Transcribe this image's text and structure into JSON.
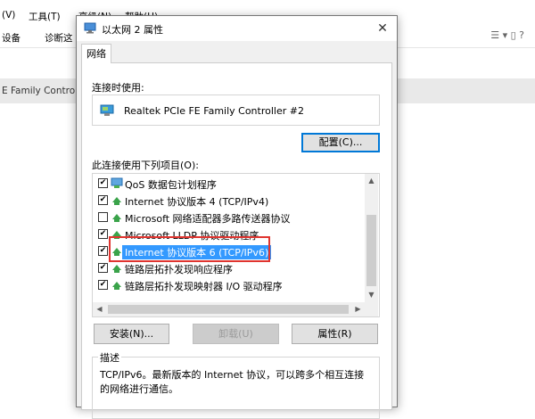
{
  "background": {
    "menu": [
      "(V)",
      "工具(T)",
      "高级(N)",
      "帮助(H)"
    ],
    "toolbar": [
      "设备",
      "诊断这"
    ],
    "list_item": "E Family Contro",
    "view_icons": "☰ ▾ ▯ ?"
  },
  "dialog": {
    "title": "以太网 2 属性",
    "close": "✕",
    "tab": "网络",
    "connect_using_label": "连接时使用:",
    "adapter_name": "Realtek PCIe FE Family Controller #2",
    "configure_button": "配置(C)...",
    "items_label": "此连接使用下列项目(O):",
    "items": [
      {
        "label": "QoS 数据包计划程序",
        "checked": true,
        "icon": "qos-icon"
      },
      {
        "label": "Internet 协议版本 4 (TCP/IPv4)",
        "checked": true,
        "icon": "protocol-icon"
      },
      {
        "label": "Microsoft 网络适配器多路传送器协议",
        "checked": false,
        "icon": "protocol-icon"
      },
      {
        "label": "Microsoft LLDP 协议驱动程序",
        "checked": true,
        "icon": "protocol-icon"
      },
      {
        "label": "Internet 协议版本 6 (TCP/IPv6)",
        "checked": true,
        "icon": "protocol-icon",
        "selected": true
      },
      {
        "label": "链路层拓扑发现响应程序",
        "checked": true,
        "icon": "protocol-icon"
      },
      {
        "label": "链路层拓扑发现映射器 I/O 驱动程序",
        "checked": true,
        "icon": "protocol-icon"
      }
    ],
    "install_button": "安装(N)...",
    "uninstall_button": "卸载(U)",
    "properties_button": "属性(R)",
    "description_title": "描述",
    "description_text": "TCP/IPv6。最新版本的 Internet 协议，可以跨多个相互连接的网络进行通信。",
    "check_mark": "✔",
    "colors": {
      "selection": "#3399ff",
      "highlight_box": "#e0342f",
      "accent": "#0078d7"
    }
  }
}
